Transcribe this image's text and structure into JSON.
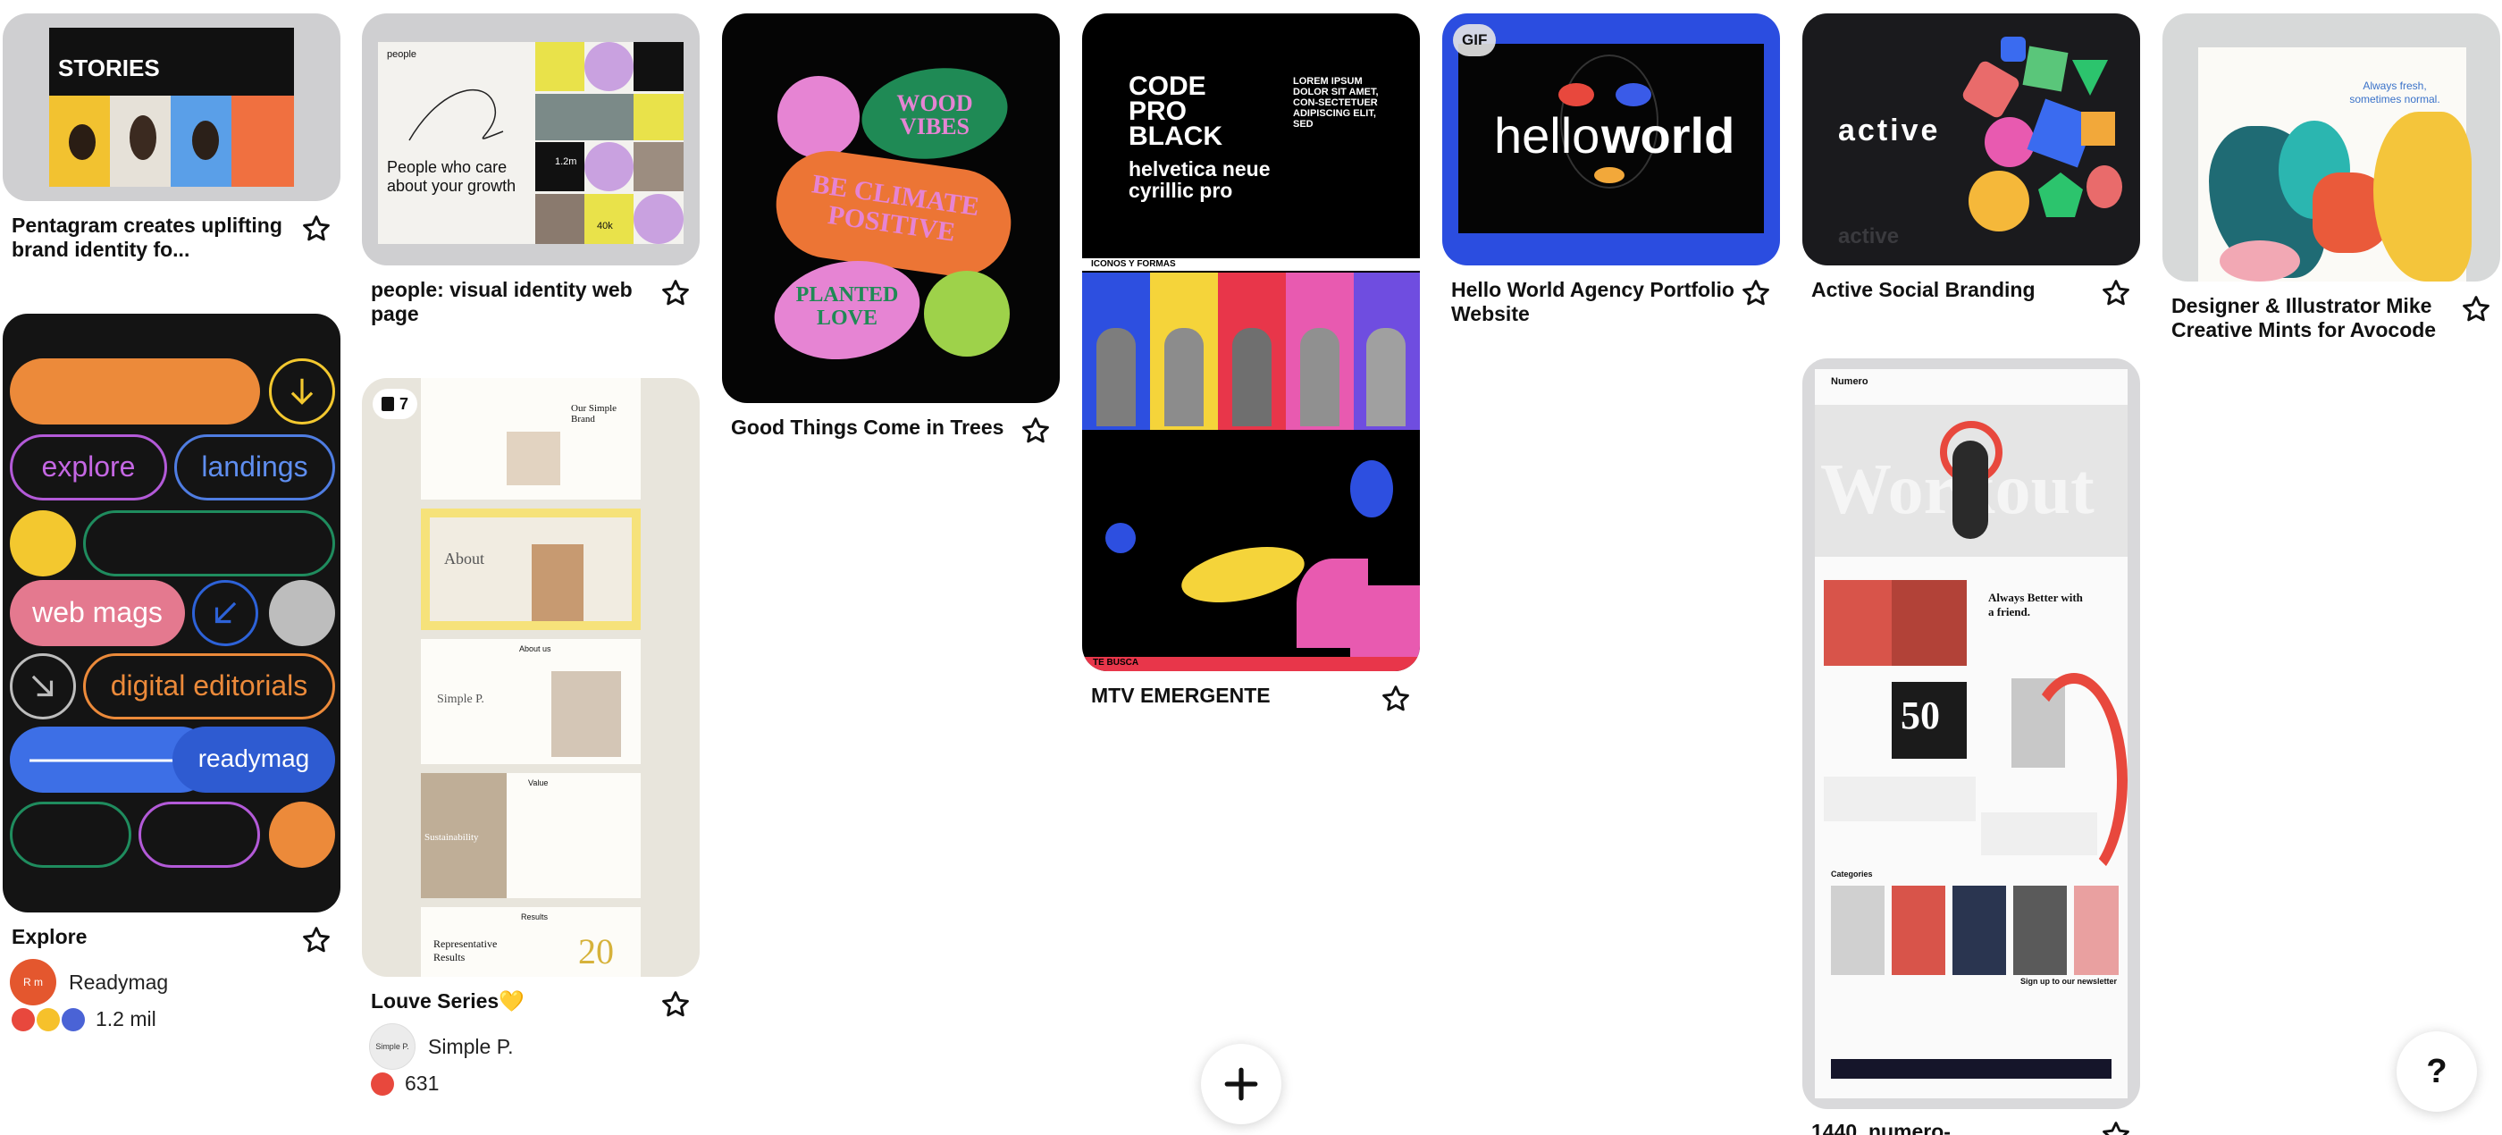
{
  "pins": {
    "p1": {
      "title": "Pentagram creates uplifting brand identity fo...",
      "img": {
        "site_title": "STORIES"
      }
    },
    "p2": {
      "title": "people: visual identity web page",
      "img": {
        "headline": "People who care about your growth",
        "brand": "people",
        "stat": "1.2m",
        "stat2": "40k"
      }
    },
    "p3": {
      "title": "Good Things Come in Trees",
      "img": {
        "s1": "WOOD VIBES",
        "s2": "BE CLIMATE POSITIVE",
        "s3": "PLANTED LOVE"
      }
    },
    "p4": {
      "title": "MTV EMERGENTE",
      "img": {
        "l1": "CODE PRO BLACK",
        "l2": "helvetica neue cyrillic pro",
        "lorem": "LOREM IPSUM DOLOR SIT AMET, CON-SECTETUER ADIPISCING ELIT, SED",
        "band": "ICONOS Y FORMAS",
        "band2": "TE BUSCA"
      }
    },
    "p5": {
      "title": "Hello World Agency Portfolio Website",
      "badge": "GIF",
      "img": {
        "hello": "hello",
        "world": "world"
      }
    },
    "p6": {
      "title": "Active Social Branding",
      "img": {
        "word": "active",
        "faint": "active"
      }
    },
    "p7": {
      "title": "Designer & Illustrator Mike Creative Mints for Avocode",
      "img": {
        "tag": "Always fresh, sometimes normal."
      }
    },
    "p8": {
      "title": "Explore",
      "creator": "Readymag",
      "avatar_text": "R m",
      "reactions": "1.2 mil",
      "img": {
        "b1": "explore",
        "b2": "landings",
        "b3": "web mags",
        "b4": "digital editorials",
        "b5": "readymag"
      }
    },
    "p9": {
      "title": "Louve Series💛",
      "count": "7",
      "creator": "Simple P.",
      "avatar_text": "Simple P.",
      "reactions": "631",
      "img": {
        "c1": "Our Simple Brand",
        "c2": "About",
        "c3": "About us",
        "c4": "Simple P.",
        "c5": "Value",
        "c6": "Sustainability",
        "c7": "Results",
        "c8": "Representative Results",
        "c9": "20"
      }
    },
    "p10": {
      "title": "1440_numero-",
      "img": {
        "brand": "Numero",
        "hero": "Workout",
        "h1": "Always Better with a friend.",
        "num": "50",
        "cat": "Categories",
        "news": "Sign up to our newsletter"
      }
    }
  },
  "fab": {
    "add_label": "+"
  },
  "help": {
    "label": "?"
  },
  "colors": {
    "accent_red": "#e60023",
    "gif_blue": "#2b4de0"
  }
}
